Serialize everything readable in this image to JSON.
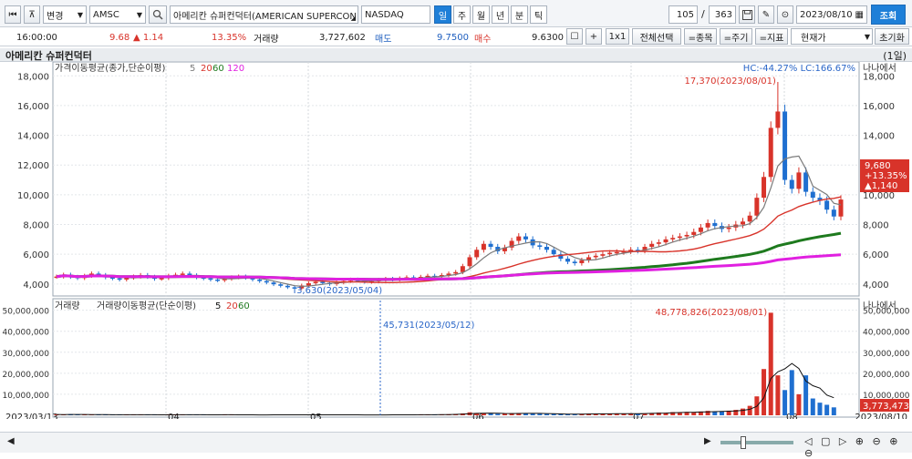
{
  "toolbar": {
    "change_label": "변경",
    "ticker": "AMSC",
    "stock_name": "아메리칸 슈퍼컨덕터(AMERICAN SUPERCON",
    "exchange": "NASDAQ",
    "periods": [
      "일",
      "주",
      "월",
      "년",
      "분",
      "틱"
    ],
    "active_period": "일",
    "count_current": "105",
    "count_sep": "/",
    "count_total": "363",
    "date": "2023/08/10",
    "search_label": "조회"
  },
  "quote": {
    "time": "16:00:00",
    "price": "9.68",
    "change": "▲ 1.14",
    "change_pct": "13.35%",
    "volume_label": "거래량",
    "volume": "3,727,602",
    "ask_label": "매도",
    "ask": "9.7500",
    "bid_label": "매수",
    "bid": "9.6300",
    "btn_plus": "+",
    "btn_1x1": "1x1",
    "btn_select_all": "전체선택",
    "btn_item": "=종목",
    "btn_period": "=주기",
    "btn_indicator": "=지표",
    "price_type": "현재가",
    "btn_reset": "초기화"
  },
  "chart_header": {
    "title": "아메리칸 슈퍼컨덕터",
    "period_tag": "(1일)"
  },
  "chart_data": {
    "type": "candlestick",
    "price_legend": "가격이동평균(종가,단순이평)",
    "ma_periods": [
      "5",
      "20",
      "60",
      "120"
    ],
    "ma_colors": [
      "#7a7a7a",
      "#d8332a",
      "#1e7a1e",
      "#e020e0"
    ],
    "hc_lc": "HC:-44.27%  LC:166.67%",
    "price_yticks": [
      "18,000",
      "16,000",
      "14,000",
      "12,000",
      "10,000",
      "8,000",
      "6,000",
      "4,000"
    ],
    "price_ylim": [
      3500,
      18200
    ],
    "x_labels": [
      "2023/03/13",
      "04",
      "05",
      "06",
      "07",
      "08",
      "2023/08/10"
    ],
    "annot_high": "17,370(2023/08/01)",
    "annot_low": "3,630(2023/05/04)",
    "last_price": "9,680",
    "last_change_pct": "+13.35%",
    "last_change": "▲1,140",
    "volume_legend_1": "거래량",
    "volume_legend_2": "거래량이동평균(단순이평)",
    "volume_ma_periods": [
      "5",
      "20",
      "60"
    ],
    "volume_yticks": [
      "50,000,000",
      "40,000,000",
      "30,000,000",
      "20,000,000",
      "10,000,000"
    ],
    "volume_ylim": [
      0,
      52000000
    ],
    "annot_vol_high": "48,778,826(2023/08/01)",
    "annot_vol_low": "45,731(2023/05/12)",
    "last_volume": "3,773,473",
    "unit_label": "나나에서",
    "closes": [
      4500,
      4620,
      4480,
      4400,
      4550,
      4700,
      4600,
      4450,
      4380,
      4300,
      4420,
      4500,
      4600,
      4480,
      4350,
      4400,
      4550,
      4620,
      4700,
      4580,
      4450,
      4380,
      4300,
      4250,
      4350,
      4450,
      4500,
      4420,
      4300,
      4200,
      4100,
      3980,
      3880,
      3780,
      3700,
      3900,
      4050,
      4150,
      4080,
      4000,
      4100,
      4200,
      4300,
      4250,
      4150,
      4180,
      4280,
      4350,
      4300,
      4380,
      4450,
      4400,
      4480,
      4550,
      4520,
      4600,
      4700,
      4800,
      5200,
      5800,
      6300,
      6700,
      6500,
      6200,
      6450,
      6900,
      7200,
      7000,
      6600,
      6500,
      6300,
      6000,
      5700,
      5500,
      5400,
      5600,
      5800,
      5900,
      6000,
      6100,
      6150,
      6200,
      6300,
      6250,
      6500,
      6700,
      6800,
      7000,
      7100,
      7200,
      7300,
      7500,
      7800,
      8100,
      7900,
      7700,
      7800,
      8000,
      8200,
      8600,
      9800,
      11200,
      14500,
      15600,
      11000,
      10400,
      11500,
      10200,
      9800,
      9600,
      9000,
      8540,
      9680
    ],
    "volumes": [
      0.4,
      0.3,
      0.5,
      0.3,
      0.4,
      0.2,
      0.3,
      0.3,
      0.2,
      0.3,
      0.3,
      0.2,
      0.2,
      0.3,
      0.2,
      0.2,
      0.3,
      0.3,
      0.2,
      0.2,
      0.2,
      0.3,
      0.2,
      0.2,
      0.3,
      0.2,
      0.2,
      0.2,
      0.1,
      0.2,
      0.2,
      0.3,
      0.2,
      0.2,
      0.2,
      0.2,
      0.2,
      0.2,
      0.2,
      0.2,
      0.2,
      0.2,
      0.2,
      0.2,
      0.1,
      0.2,
      0.2,
      0.2,
      0.3,
      0.2,
      0.2,
      0.2,
      0.3,
      0.3,
      0.3,
      0.4,
      0.5,
      0.6,
      0.9,
      1.4,
      1.1,
      0.9,
      0.8,
      0.7,
      0.8,
      1.0,
      1.1,
      0.9,
      0.8,
      0.7,
      0.6,
      0.6,
      0.5,
      0.5,
      0.6,
      0.7,
      0.8,
      0.6,
      0.7,
      0.7,
      0.8,
      0.8,
      0.9,
      0.8,
      0.9,
      1.1,
      1.3,
      1.2,
      1.5,
      1.3,
      1.6,
      1.5,
      1.8,
      2.1,
      1.7,
      1.9,
      2.2,
      2.6,
      3.2,
      4.5,
      9.0,
      22.0,
      48.8,
      19.0,
      12.0,
      21.5,
      10.0,
      19.0,
      8.0,
      6.0,
      5.0,
      3.77
    ]
  }
}
